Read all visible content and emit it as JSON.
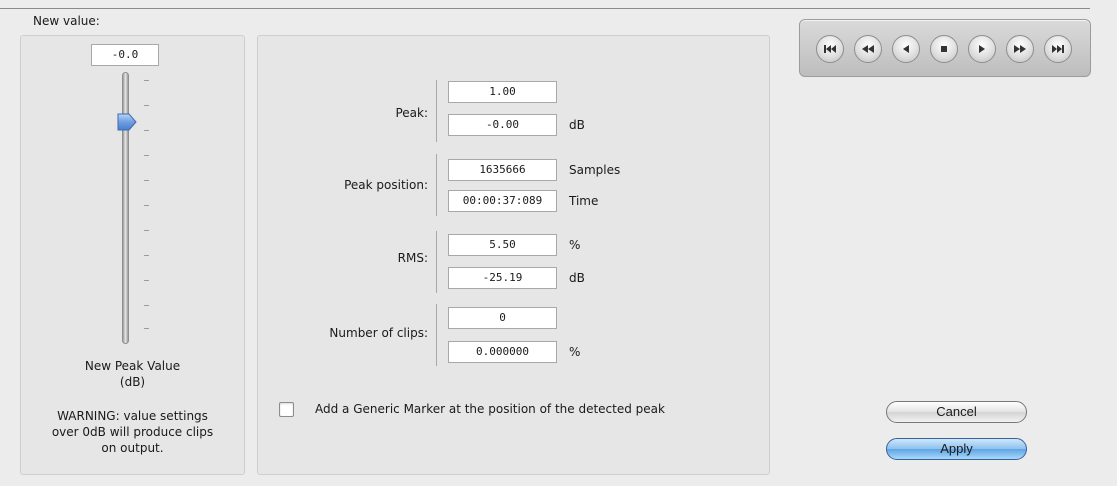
{
  "labels": {
    "new_value": "New value:",
    "peak": "Peak:",
    "peak_position": "Peak position:",
    "rms": "RMS:",
    "number_of_clips": "Number of clips:",
    "checkbox": "Add a Generic Marker at the position of the detected peak",
    "new_peak_value_line1": "New Peak Value",
    "new_peak_value_line2": "(dB)",
    "warning_line1": "WARNING: value settings",
    "warning_line2": "over 0dB will produce clips",
    "warning_line3": "on output."
  },
  "slider": {
    "value_text": "-0.0"
  },
  "fields": {
    "peak_linear": "1.00",
    "peak_db": "-0.00",
    "peak_samples": "1635666",
    "peak_time": "00:00:37:089",
    "rms_percent": "5.50",
    "rms_db": "-25.19",
    "clips_count": "0",
    "clips_percent": "0.000000"
  },
  "units": {
    "db": "dB",
    "samples": "Samples",
    "time": "Time",
    "percent": "%"
  },
  "checkbox": {
    "checked": false
  },
  "buttons": {
    "cancel": "Cancel",
    "apply": "Apply"
  },
  "transport": {
    "icons": [
      "skip-to-start-icon",
      "rewind-icon",
      "play-backward-icon",
      "stop-icon",
      "play-icon",
      "fast-forward-icon",
      "skip-to-end-icon"
    ]
  },
  "colors": {
    "accent": "#5fa4e4",
    "thumb": "#6f9ee0"
  }
}
